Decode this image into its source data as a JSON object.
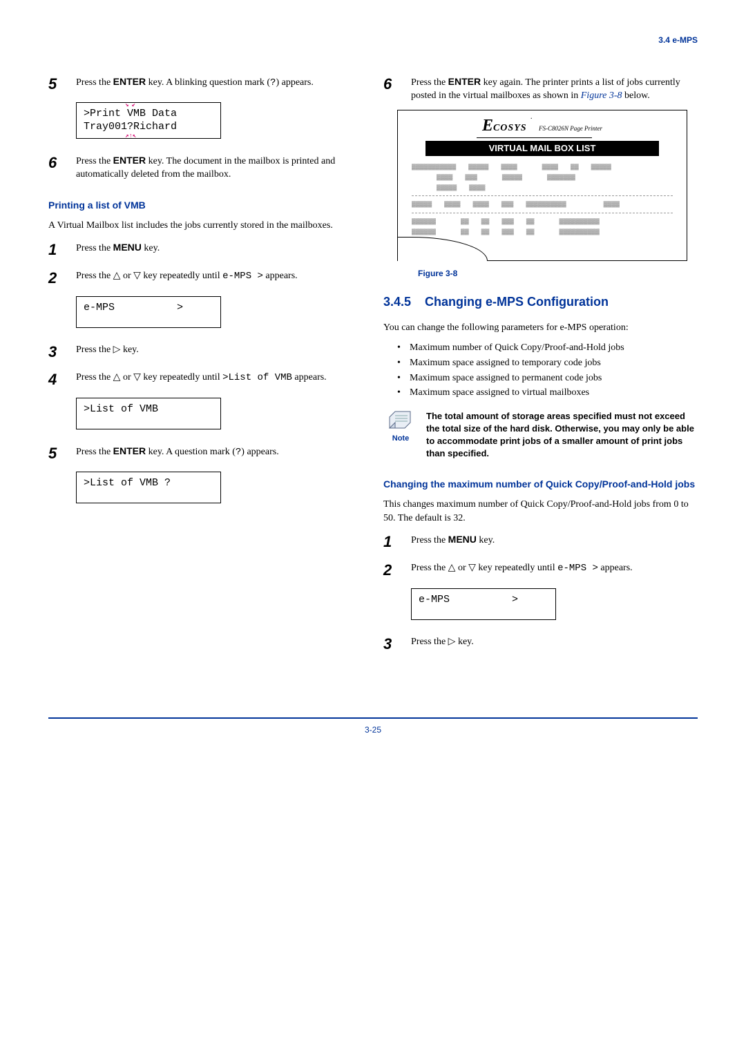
{
  "header_section": "3.4 e-MPS",
  "left": {
    "step5": {
      "num": "5",
      "text_a": "Press the ",
      "key": "ENTER",
      "text_b": " key. A blinking question mark (",
      "qmark": "?",
      "text_c": ") appears."
    },
    "lcd1_line1_a": ">Print ",
    "lcd1_line1_blink": "V",
    "lcd1_line1_b": "MB Data",
    "lcd1_line2_a": "Tray001",
    "lcd1_line2_blink": "?",
    "lcd1_line2_b": "Richard",
    "step6": {
      "num": "6",
      "text_a": "Press the ",
      "key": "ENTER",
      "text_b": " key. The document in the mailbox is printed and automatically deleted from the mailbox."
    },
    "h3_vmb": "Printing a list of VMB",
    "intro_vmb": "A Virtual Mailbox list includes the jobs currently stored in the mailboxes.",
    "step1b": {
      "num": "1",
      "text_a": "Press the ",
      "key": "MENU",
      "text_b": " key."
    },
    "step2b": {
      "num": "2",
      "text_a": "Press the ",
      "text_b": " or ",
      "text_c": " key repeatedly until ",
      "mono": "e-MPS >",
      "text_d": " appears."
    },
    "lcd_emps": "e-MPS          >",
    "step3b": {
      "num": "3",
      "text_a": "Press the ",
      "text_b": " key."
    },
    "step4b": {
      "num": "4",
      "text_a": "Press the ",
      "text_b": " or ",
      "text_c": " key repeatedly until ",
      "mono": ">List of VMB",
      "text_d": " appears."
    },
    "lcd_list": ">List of VMB",
    "step5b": {
      "num": "5",
      "text_a": "Press the ",
      "key": "ENTER",
      "text_b": " key. A question mark (",
      "qmark": "?",
      "text_c": ") appears."
    },
    "lcd_listq": ">List of VMB ?"
  },
  "right": {
    "step6": {
      "num": "6",
      "text_a": "Press the ",
      "key": "ENTER",
      "text_b": " key again. The printer prints a list of jobs currently posted in the virtual mailboxes as shown in ",
      "link": "Figure 3-8",
      "text_c": " below."
    },
    "figure": {
      "brand_e": "E",
      "brand_rest": "COSYS",
      "model": "FS-C8026N  Page Printer",
      "bar": "VIRTUAL MAIL BOX LIST",
      "caption": "Figure 3-8"
    },
    "h2_num": "3.4.5",
    "h2_title": "Changing e-MPS Configuration",
    "intro_cfg": "You can change the following parameters for e-MPS operation:",
    "bullets": [
      "Maximum number of Quick Copy/Proof-and-Hold jobs",
      "Maximum space assigned to temporary code jobs",
      "Maximum space assigned to permanent code jobs",
      "Maximum space assigned to virtual mailboxes"
    ],
    "note_label": "Note",
    "note_text": "The total amount of storage areas specified must not exceed the total size of the hard disk. Otherwise, you may only be able to accommodate print jobs of a smaller amount of print jobs than specified.",
    "h3_qc": "Changing the maximum number of Quick Copy/Proof-and-Hold jobs",
    "intro_qc": "This changes maximum number of Quick Copy/Proof-and-Hold jobs from 0 to 50. The default is 32.",
    "step1c": {
      "num": "1",
      "text_a": "Press the ",
      "key": "MENU",
      "text_b": " key."
    },
    "step2c": {
      "num": "2",
      "text_a": "Press the ",
      "text_b": " or ",
      "text_c": " key repeatedly until ",
      "mono": "e-MPS >",
      "text_d": " appears."
    },
    "lcd_emps2": "e-MPS          >",
    "step3c": {
      "num": "3",
      "text_a": "Press the ",
      "text_b": " key."
    }
  },
  "footer": "3-25"
}
